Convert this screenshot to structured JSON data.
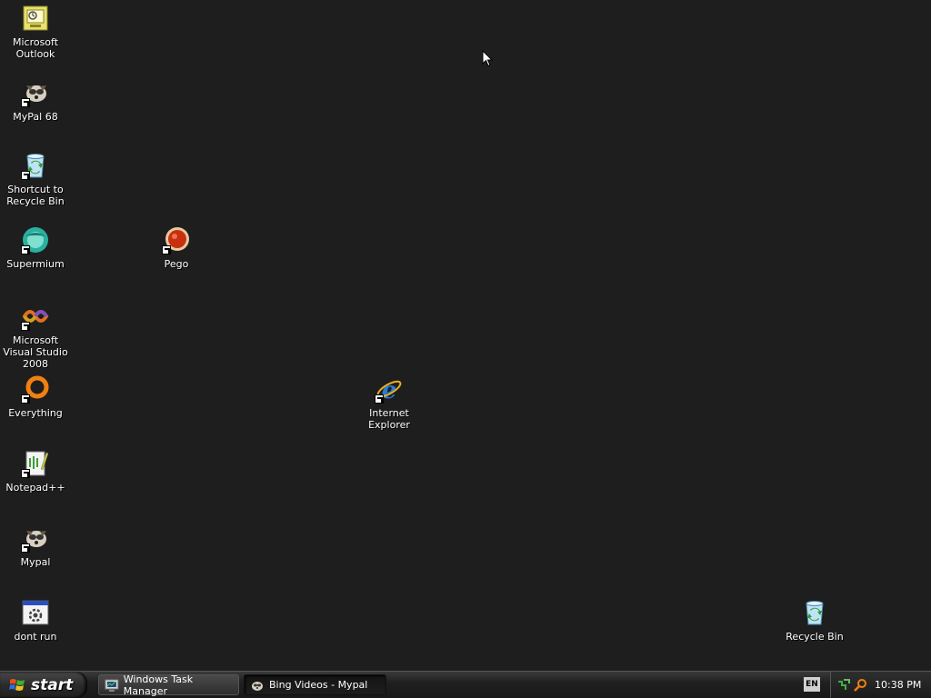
{
  "desktop": {
    "icons": [
      {
        "label": "Microsoft Outlook",
        "icon": "outlook-icon"
      },
      {
        "label": "MyPal 68",
        "icon": "mypal-icon"
      },
      {
        "label": "Shortcut to Recycle Bin",
        "icon": "recycle-bin-icon"
      },
      {
        "label": "Supermium",
        "icon": "supermium-icon"
      },
      {
        "label": "Pego",
        "icon": "pego-icon"
      },
      {
        "label": "Microsoft Visual Studio 2008",
        "icon": "visual-studio-icon"
      },
      {
        "label": "Everything",
        "icon": "everything-icon"
      },
      {
        "label": "Internet Explorer",
        "icon": "internet-explorer-icon"
      },
      {
        "label": "Notepad++",
        "icon": "notepadpp-icon"
      },
      {
        "label": "Mypal",
        "icon": "mypal-icon"
      },
      {
        "label": "dont run",
        "icon": "program-icon"
      },
      {
        "label": "Recycle Bin",
        "icon": "recycle-bin-icon"
      }
    ]
  },
  "taskbar": {
    "start_label": "start",
    "buttons": [
      {
        "label": "Windows Task Manager",
        "icon": "task-manager-icon"
      },
      {
        "label": "Bing Videos - Mypal",
        "icon": "mypal-icon"
      }
    ],
    "language": "EN",
    "clock": "10:38 PM"
  },
  "colors": {
    "desktop_background": "#1e1e1e",
    "taskbar": "#202020"
  }
}
